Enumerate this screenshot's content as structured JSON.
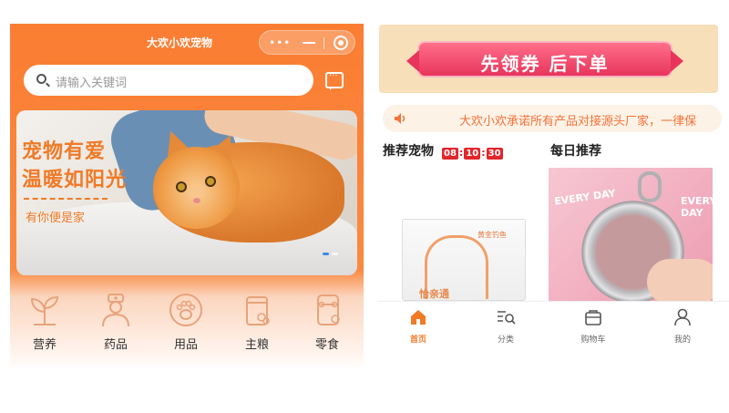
{
  "left": {
    "app_title": "大欢小欢宠物",
    "search": {
      "placeholder": "请输入关键词"
    },
    "banner": {
      "slogan_line1": "宠物有爱",
      "slogan_line2": "温暖如阳光",
      "slogan_line3": "有你便是家"
    },
    "categories": [
      {
        "label": "营养",
        "icon": "sprout-icon"
      },
      {
        "label": "药品",
        "icon": "doctor-icon"
      },
      {
        "label": "用品",
        "icon": "paw-icon"
      },
      {
        "label": "主粮",
        "icon": "food-bag-icon"
      },
      {
        "label": "零食",
        "icon": "bone-snack-icon"
      }
    ]
  },
  "right": {
    "coupon_text": "先领券  后下单",
    "notice_text": "大欢小欢承诺所有产品对接源头厂家，一律保",
    "recommend_pets": {
      "title": "推荐宠物",
      "timer": {
        "h": "08",
        "m": "10",
        "s": "30"
      },
      "product_brand": "黄金钓鱼",
      "product_name": "怡亲通"
    },
    "daily": {
      "title": "每日推荐",
      "label1": "EVERY DAY",
      "label2": "EVERY DAY"
    },
    "tabbar": [
      {
        "label": "首页",
        "icon": "home-icon",
        "active": true
      },
      {
        "label": "分类",
        "icon": "category-search-icon",
        "active": false
      },
      {
        "label": "购物车",
        "icon": "cart-icon",
        "active": false
      },
      {
        "label": "我的",
        "icon": "user-icon",
        "active": false
      }
    ]
  },
  "colors": {
    "accent": "#fa7d32",
    "timer_red": "#e3262b",
    "coupon_pink": "#e8355b"
  }
}
